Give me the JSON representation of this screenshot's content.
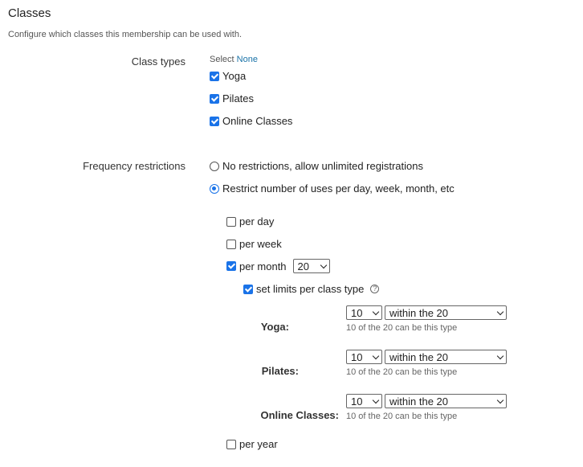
{
  "section": {
    "title": "Classes",
    "description": "Configure which classes this membership can be used with."
  },
  "class_types": {
    "label": "Class types",
    "select_prefix": "Select",
    "select_none_link": "None",
    "items": [
      {
        "label": "Yoga",
        "checked": true
      },
      {
        "label": "Pilates",
        "checked": true
      },
      {
        "label": "Online Classes",
        "checked": true
      }
    ]
  },
  "frequency": {
    "label": "Frequency restrictions",
    "options": [
      {
        "label": "No restrictions, allow unlimited registrations",
        "selected": false
      },
      {
        "label": "Restrict number of uses per day, week, month, etc",
        "selected": true
      }
    ],
    "periods": {
      "per_day": {
        "label": "per day",
        "checked": false
      },
      "per_week": {
        "label": "per week",
        "checked": false
      },
      "per_month": {
        "label": "per month",
        "checked": true,
        "value": "20"
      },
      "per_year": {
        "label": "per year",
        "checked": false
      }
    },
    "set_limits": {
      "label": "set limits per class type",
      "checked": true,
      "help_icon": "question-circle-icon"
    },
    "class_limits": [
      {
        "label": "Yoga:",
        "count": "10",
        "scope": "within the 20",
        "hint": "10 of the 20 can be this type"
      },
      {
        "label": "Pilates:",
        "count": "10",
        "scope": "within the 20",
        "hint": "10 of the 20 can be this type"
      },
      {
        "label": "Online Classes:",
        "count": "10",
        "scope": "within the 20",
        "hint": "10 of the 20 can be this type"
      }
    ]
  },
  "colors": {
    "accent": "#1a73e8",
    "link": "#1a73a8"
  }
}
